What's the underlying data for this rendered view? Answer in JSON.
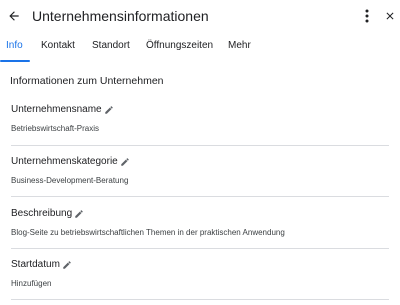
{
  "header": {
    "title": "Unternehmensinformationen",
    "back_icon": "arrow-back-icon",
    "more_icon": "more-vert-icon",
    "close_icon": "close-icon"
  },
  "tabs": [
    {
      "label": "Info",
      "active": true
    },
    {
      "label": "Kontakt",
      "active": false
    },
    {
      "label": "Standort",
      "active": false
    },
    {
      "label": "Öffnungszeiten",
      "active": false
    },
    {
      "label": "Mehr",
      "active": false
    }
  ],
  "section": {
    "heading": "Informationen zum Unternehmen"
  },
  "fields": [
    {
      "label": "Unternehmensname",
      "value": "Betriebswirtschaft-Praxis"
    },
    {
      "label": "Unternehmenskategorie",
      "value": "Business-Development-Beratung"
    },
    {
      "label": "Beschreibung",
      "value": "Blog-Seite zu betriebswirtschaftlichen Themen in der praktischen Anwendung"
    },
    {
      "label": "Startdatum",
      "value": "Hinzufügen"
    }
  ],
  "colors": {
    "accent": "#1a73e8",
    "text": "#202124",
    "divider": "#dadce0"
  }
}
